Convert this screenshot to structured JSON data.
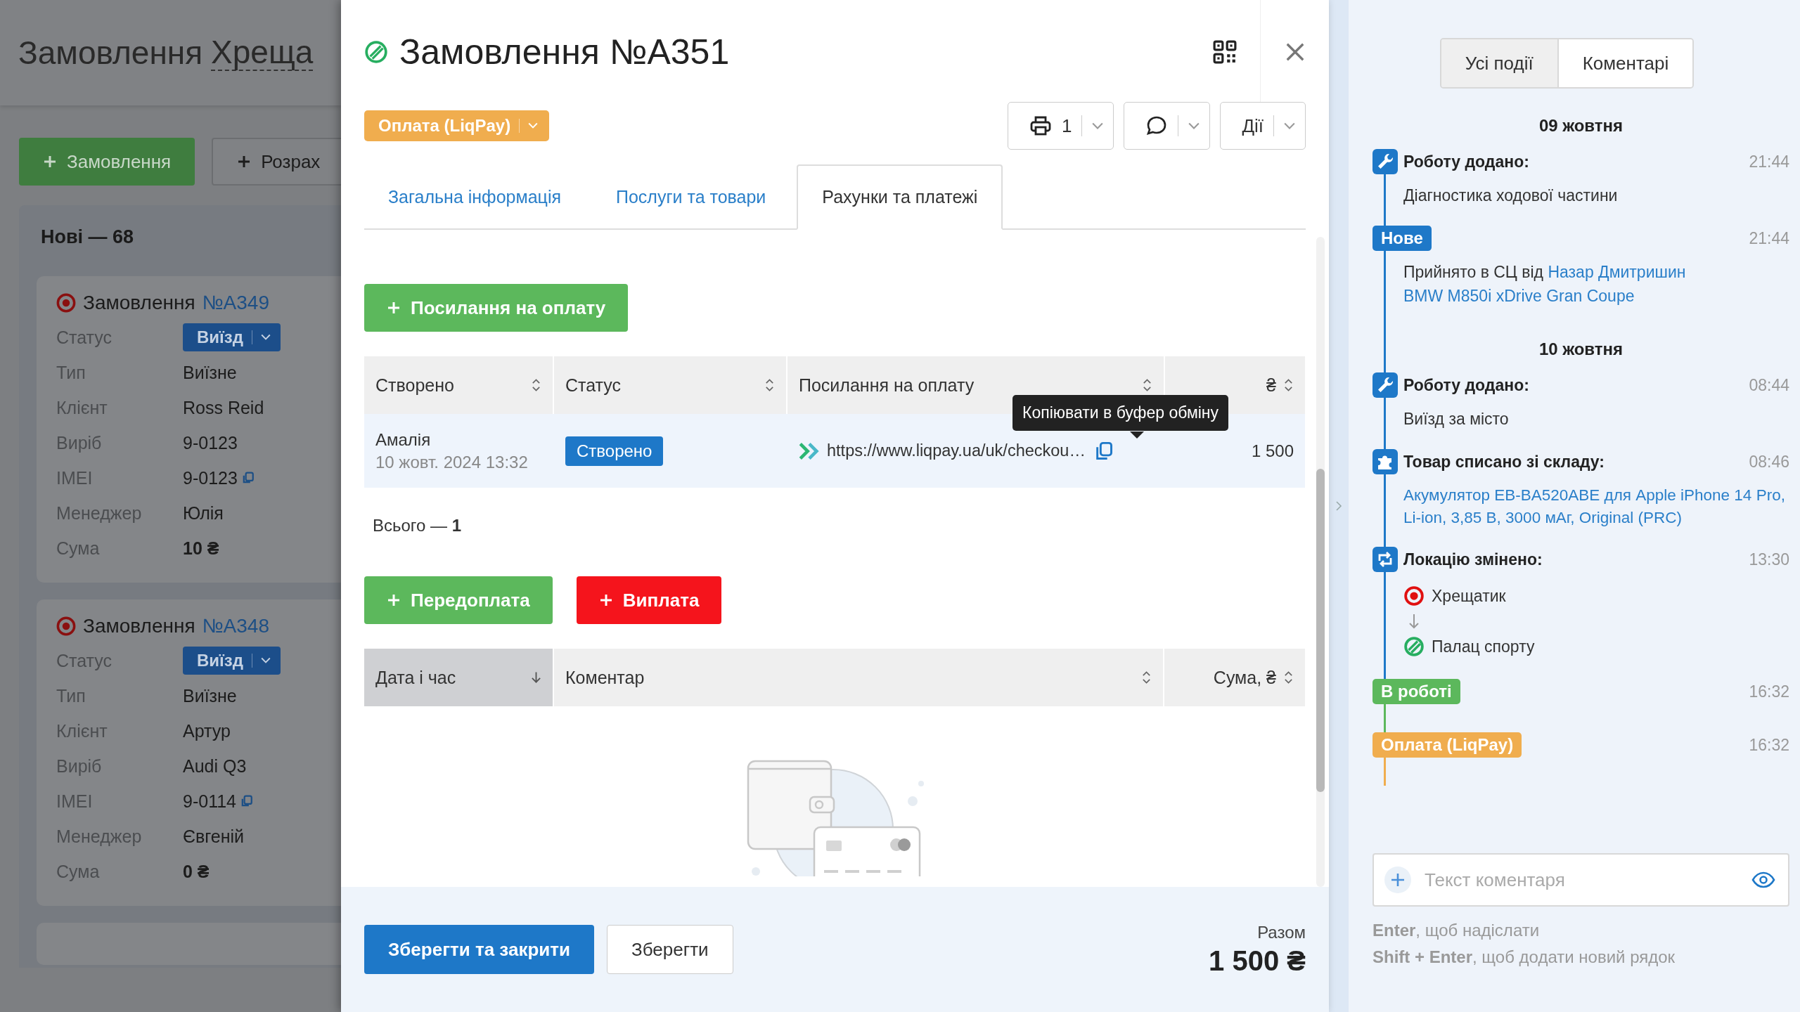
{
  "background_page": {
    "title": "Замовлення",
    "location": "Хреща",
    "buttons": [
      {
        "label": "Замовлення",
        "kind": "primary"
      },
      {
        "label": "Розрах",
        "kind": "secondary"
      }
    ],
    "column_title": "Нові — 68",
    "cards": [
      {
        "title": "Замовлення",
        "number": "№A349",
        "fields": [
          {
            "label": "Статус",
            "value": "Виїзд",
            "kind": "status"
          },
          {
            "label": "Тип",
            "value": "Виїзне",
            "kind": "text"
          },
          {
            "label": "Клієнт",
            "value": "Ross Reid",
            "kind": "text"
          },
          {
            "label": "Виріб",
            "value": "9-0123",
            "kind": "text"
          },
          {
            "label": "IMEI",
            "value": "9-0123",
            "kind": "copy"
          },
          {
            "label": "Менеджер",
            "value": "Юлія",
            "kind": "text"
          },
          {
            "label": "Сума",
            "value": "10 ₴",
            "kind": "amount"
          }
        ]
      },
      {
        "title": "Замовлення",
        "number": "№A348",
        "fields": [
          {
            "label": "Статус",
            "value": "Виїзд",
            "kind": "status"
          },
          {
            "label": "Тип",
            "value": "Виїзне",
            "kind": "text"
          },
          {
            "label": "Клієнт",
            "value": "Артур",
            "kind": "text"
          },
          {
            "label": "Виріб",
            "value": "Audi Q3",
            "kind": "text"
          },
          {
            "label": "IMEI",
            "value": "9-0114",
            "kind": "copy"
          },
          {
            "label": "Менеджер",
            "value": "Євгеній",
            "kind": "text"
          },
          {
            "label": "Сума",
            "value": "0 ₴",
            "kind": "amount"
          }
        ]
      }
    ]
  },
  "modal": {
    "title": "Замовлення №A351",
    "status": "Оплата (LiqPay)",
    "print_count": "1",
    "actions_label": "Дії",
    "tabs": [
      {
        "label": "Загальна інформація",
        "selected": false
      },
      {
        "label": "Послуги та товари",
        "selected": false
      },
      {
        "label": "Рахунки та платежі",
        "selected": true
      }
    ],
    "payment_link_button": "Посилання на оплату",
    "links_table": {
      "columns": [
        {
          "label": "Створено",
          "sorted": false
        },
        {
          "label": "Статус",
          "sorted": false
        },
        {
          "label": "Посилання на оплату",
          "sorted": false
        },
        {
          "label": "₴",
          "sorted": false
        }
      ],
      "rows": [
        {
          "author": "Амалія",
          "date": "10 жовт. 2024 13:32",
          "status": "Створено",
          "url": "https://www.liqpay.ua/uk/checkou…",
          "amount": "1 500"
        }
      ]
    },
    "tooltip": "Копіювати в буфер обміну",
    "total_count": "Всього — **1**",
    "prepay_button": "Передоплата",
    "payout_button": "Виплата",
    "payments_table": {
      "columns": [
        {
          "label": "Дата і час",
          "sorted": true
        },
        {
          "label": "Коментар",
          "sorted": false
        },
        {
          "label": "Сума, ₴",
          "sorted": false
        }
      ]
    },
    "save_close_button": "Зберегти та закрити",
    "save_button": "Зберегти",
    "total_label": "Разом",
    "total": "1 500 ₴"
  },
  "events_panel": {
    "tabs": [
      {
        "label": "Усі події",
        "selected": true
      },
      {
        "label": "Коментарі",
        "selected": false
      }
    ],
    "days": [
      {
        "date": "09 жовтня",
        "events": [
          {
            "kind": "work",
            "title": "Роботу додано:",
            "time": "21:44",
            "text": "Діагностика ходової частини"
          },
          {
            "kind": "status",
            "badge": "Нове",
            "color": "#1e78c8",
            "time": "21:44",
            "text": "Прийнято в СЦ від",
            "client": "Назар Дмитришин",
            "device": "BMW M850i xDrive Gran Coupe"
          }
        ]
      },
      {
        "date": "10 жовтня",
        "events": [
          {
            "kind": "work",
            "title": "Роботу додано:",
            "time": "08:44",
            "text": "Виїзд за місто"
          },
          {
            "kind": "product",
            "title": "Товар списано зі складу:",
            "time": "08:46",
            "product": "Акумулятор EB-BA520ABE для Apple iPhone 14 Pro, Li-ion, 3,85 В, 3000 мАг, Original (PRC)"
          },
          {
            "kind": "location",
            "title": "Локацію змінено:",
            "time": "13:30",
            "from": "Хрещатик",
            "to": "Палац спорту"
          },
          {
            "kind": "status",
            "badge": "В роботі",
            "color": "#5cb85c",
            "time": "16:32"
          },
          {
            "kind": "status",
            "badge": "Оплата (LiqPay)",
            "color": "#f0ad4e",
            "time": "16:32"
          }
        ]
      }
    ],
    "comment_placeholder": "Текст коментаря",
    "hints": [
      "**Enter**, щоб надіслати",
      "**Shift + Enter**, щоб додати новий рядок"
    ]
  }
}
